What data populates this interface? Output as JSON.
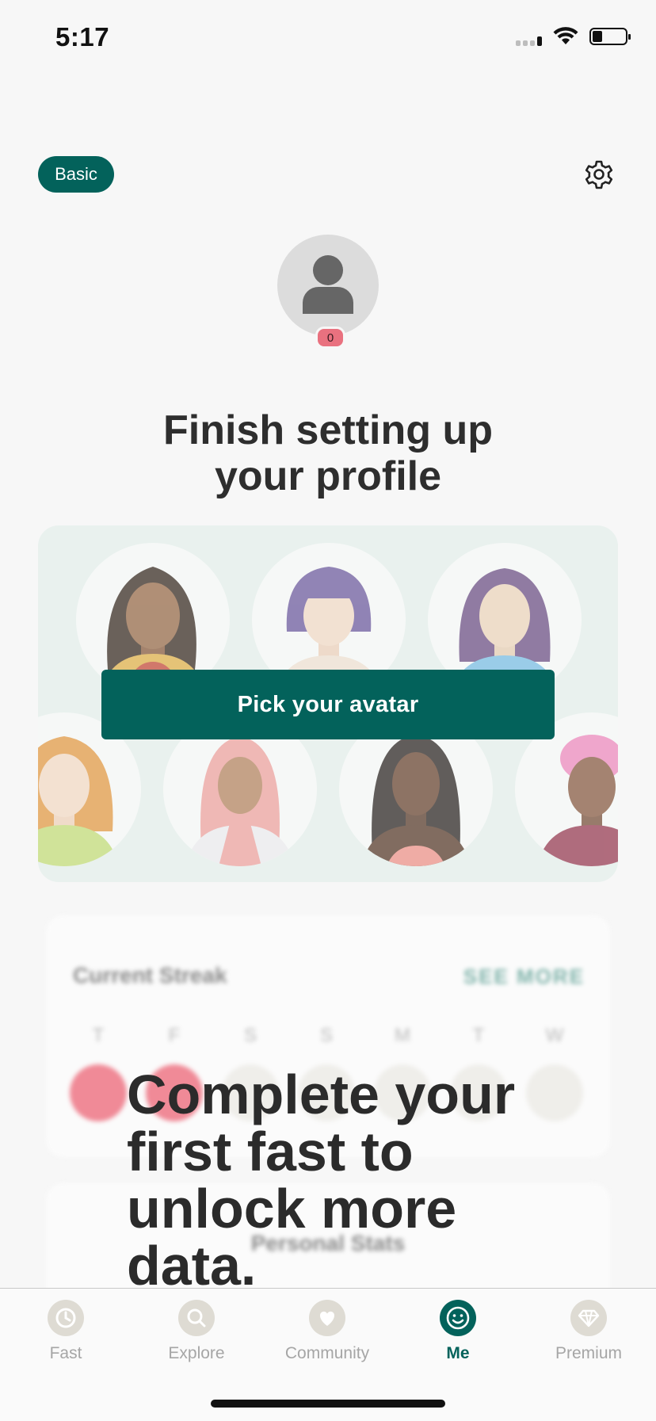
{
  "status_bar": {
    "time": "5:17"
  },
  "header": {
    "plan_label": "Basic"
  },
  "profile": {
    "badge_count": "0"
  },
  "headline": {
    "line1": "Finish setting up",
    "line2": "your profile"
  },
  "avatar_picker": {
    "button_label": "Pick your avatar"
  },
  "streak": {
    "title": "Current Streak",
    "see_more": "SEE MORE",
    "days": [
      "T",
      "F",
      "S",
      "S",
      "M",
      "T",
      "W"
    ]
  },
  "stats": {
    "title": "Personal Stats"
  },
  "locked_message": "Complete your first fast to unlock more data.",
  "tabs": [
    {
      "label": "Fast",
      "icon": "clock-icon"
    },
    {
      "label": "Explore",
      "icon": "search-icon"
    },
    {
      "label": "Community",
      "icon": "heart-icon"
    },
    {
      "label": "Me",
      "icon": "smiley-icon"
    },
    {
      "label": "Premium",
      "icon": "diamond-icon"
    }
  ],
  "colors": {
    "brand": "#03625b",
    "accent": "#e9717f"
  }
}
